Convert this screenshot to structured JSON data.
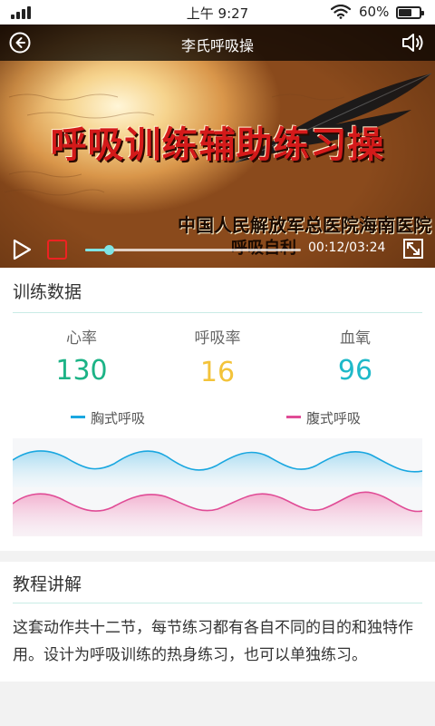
{
  "status_bar": {
    "time": "上午 9:27",
    "battery_percent": "60%",
    "icons": [
      "signal-icon",
      "wifi-icon",
      "battery-icon"
    ]
  },
  "video": {
    "title": "李氏呼吸操",
    "headline": "呼吸训练辅助练习操",
    "subtitle": "中国人民解放军总医院海南医院",
    "subtitle2": "呼吸自利",
    "timecode": "00:12/03:24",
    "progress": 0.11,
    "icons": [
      "back-icon",
      "volume-icon",
      "play-icon",
      "stop-icon",
      "fullscreen-icon"
    ],
    "colors": {
      "accent": "#7fe4e4",
      "stop": "#e22222",
      "headline": "#d41a1a"
    }
  },
  "training": {
    "title": "训练数据",
    "stats": [
      {
        "label": "心率",
        "value": "130",
        "color": "#1cb386"
      },
      {
        "label": "呼吸率",
        "value": "16",
        "color": "#f3c33a"
      },
      {
        "label": "血氧",
        "value": "96",
        "color": "#1fb9c9"
      }
    ],
    "legend": [
      {
        "label": "胸式呼吸",
        "color": "#1aa7e0"
      },
      {
        "label": "腹式呼吸",
        "color": "#e04c96"
      }
    ]
  },
  "tutorial": {
    "title": "教程讲解",
    "body": "这套动作共十二节，每节练习都有各自不同的目的和独特作用。设计为呼吸训练的热身练习，也可以单独练习。"
  }
}
